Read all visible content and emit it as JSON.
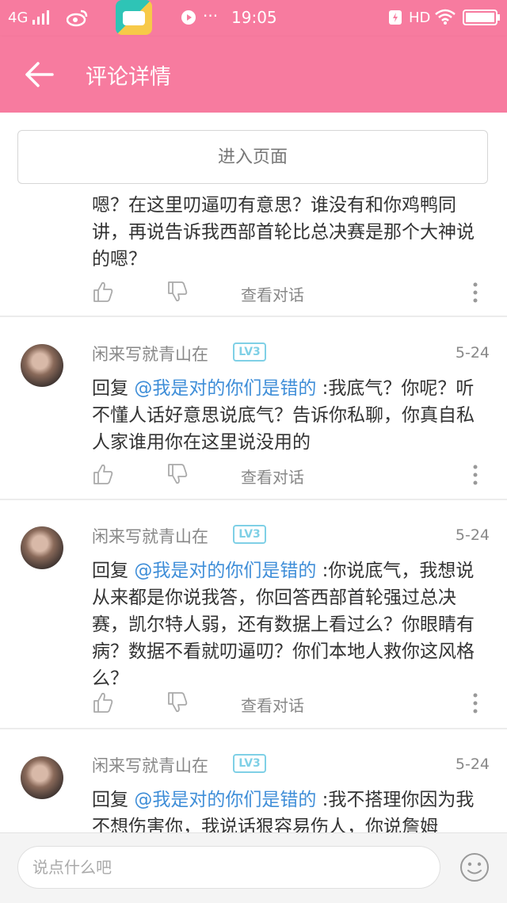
{
  "status_bar": {
    "network": "4G",
    "time": "19:05",
    "hd": "HD"
  },
  "header": {
    "title": "评论详情",
    "back_icon": "arrow-left-icon"
  },
  "enter_page_label": "进入页面",
  "top_comment": {
    "text": "嗯？在这里叨逼叨有意思？谁没有和你鸡鸭同讲，再说告诉我西部首轮比总决赛是那个大神说的嗯？",
    "view_label": "查看对话"
  },
  "comments": [
    {
      "user": "闲来写就青山在",
      "badge": "LV3",
      "date": "5-24",
      "reply_prefix": "回复",
      "mention": "@我是对的你们是错的",
      "text": ":我底气？你呢？听不懂人话好意思说底气？告诉你私聊，你真自私人家谁用你在这里说没用的",
      "view_label": "查看对话"
    },
    {
      "user": "闲来写就青山在",
      "badge": "LV3",
      "date": "5-24",
      "reply_prefix": "回复",
      "mention": "@我是对的你们是错的",
      "text": ":你说底气，我想说从来都是你说我答，你回答西部首轮强过总决赛，凯尔特人弱，还有数据上看过么？你眼睛有病？数据不看就叨逼叨？你们本地人救你这风格么？",
      "view_label": "查看对话"
    },
    {
      "user": "闲来写就青山在",
      "badge": "LV3",
      "date": "5-24",
      "reply_prefix": "回复",
      "mention": "@我是对的你们是错的",
      "text": ":我不搭理你因为我不想伤害你，我说话狠容易伤人，你说詹姆"
    }
  ],
  "bottom": {
    "placeholder": "说点什么吧"
  },
  "colors": {
    "accent": "#f77b9f",
    "mention": "#3f8ed8",
    "badge": "#7fd0e6"
  }
}
